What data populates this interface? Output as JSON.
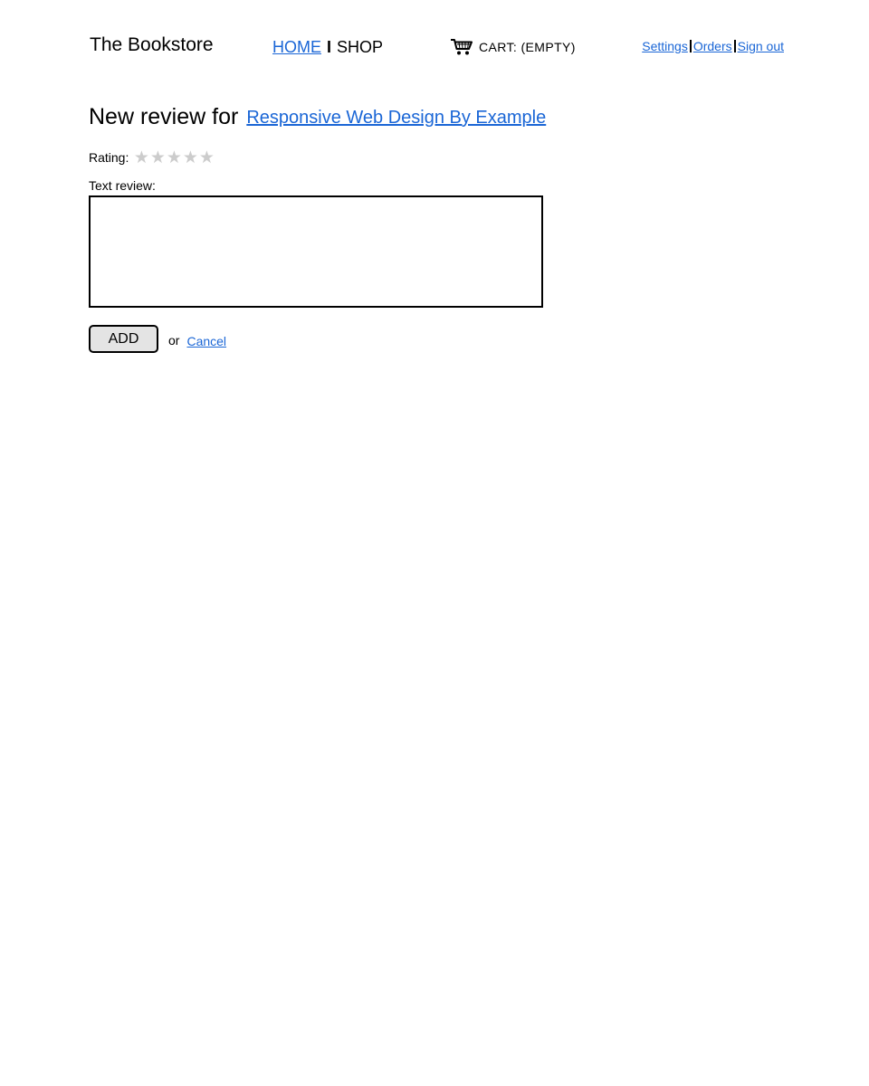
{
  "header": {
    "site_title": "The Bookstore",
    "nav": {
      "home": "HOME",
      "separator": "I",
      "shop": "SHOP"
    },
    "cart": {
      "icon": "cart-icon",
      "label": "CART: (EMPTY)"
    },
    "user_links": {
      "settings": "Settings",
      "orders": "Orders",
      "sign_out": "Sign out"
    }
  },
  "review": {
    "heading": "New review for",
    "book_title": "Responsive Web Design By Example",
    "rating_label": "Rating:",
    "rating_value": 0,
    "rating_max": 5,
    "text_label": "Text review:",
    "text_value": "",
    "add_button": "ADD",
    "or_text": "or",
    "cancel_link": "Cancel"
  },
  "colors": {
    "link": "#1a66d6",
    "star_empty": "#cccccc",
    "button_bg": "#e4e4e4"
  }
}
